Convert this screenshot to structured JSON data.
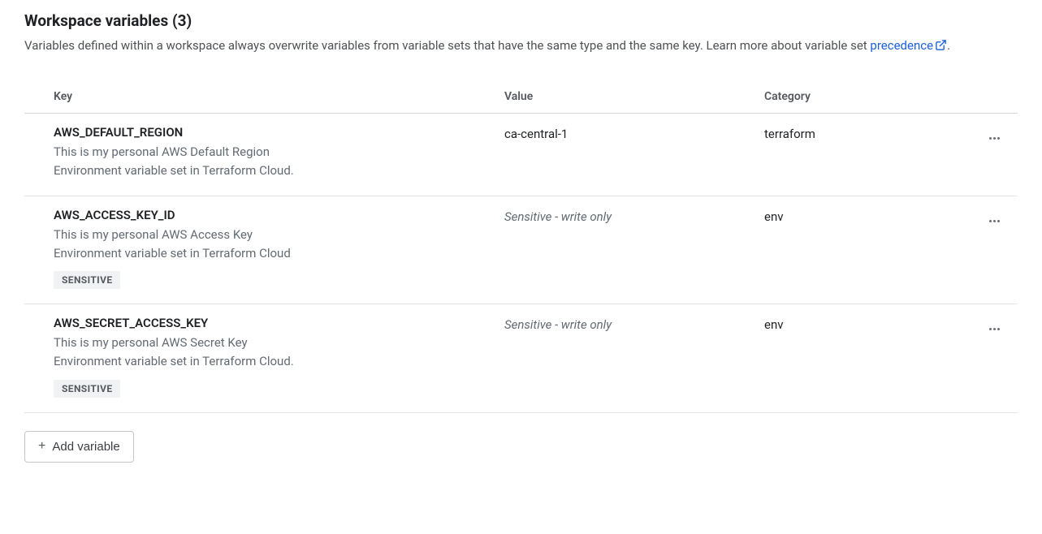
{
  "header": {
    "title_prefix": "Workspace variables",
    "count": 3,
    "subtitle_text": "Variables defined within a workspace always overwrite variables from variable sets that have the same type and the same key. Learn more about variable set ",
    "link_text": "precedence",
    "subtitle_suffix": "."
  },
  "columns": {
    "key": "Key",
    "value": "Value",
    "category": "Category"
  },
  "sensitive_badge": "SENSITIVE",
  "rows": [
    {
      "key": "AWS_DEFAULT_REGION",
      "description": "This is my personal AWS Default Region Environment variable set in Terraform Cloud.",
      "value": "ca-central-1",
      "sensitive": false,
      "category": "terraform"
    },
    {
      "key": "AWS_ACCESS_KEY_ID",
      "description": "This is my personal AWS Access Key Environment variable set in Terraform Cloud",
      "value": "Sensitive - write only",
      "sensitive": true,
      "category": "env"
    },
    {
      "key": "AWS_SECRET_ACCESS_KEY",
      "description": "This is my personal AWS Secret Key Environment variable set in Terraform Cloud.",
      "value": "Sensitive - write only",
      "sensitive": true,
      "category": "env"
    }
  ],
  "add_button": "Add variable"
}
